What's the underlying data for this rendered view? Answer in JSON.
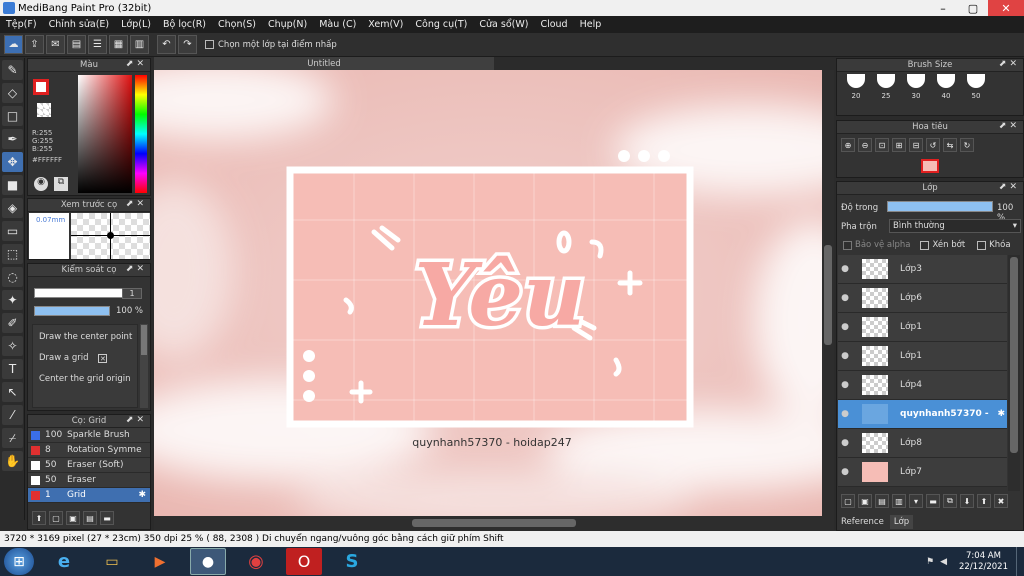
{
  "window": {
    "title": "MediBang Paint Pro (32bit)"
  },
  "menu": [
    "Tệp(F)",
    "Chỉnh sửa(E)",
    "Lớp(L)",
    "Bộ lọc(R)",
    "Chọn(S)",
    "Chụp(N)",
    "Màu (C)",
    "Xem(V)",
    "Công cụ(T)",
    "Cửa sổ(W)",
    "Cloud",
    "Help"
  ],
  "toolbar": {
    "select_layer_label": "Chọn một lớp tại điểm nhấp"
  },
  "canvas": {
    "tab_title": "Untitled",
    "art_word": "Yêu",
    "watermark": "quynhanh57370 - hoidap247"
  },
  "color_panel": {
    "title": "Màu",
    "r": "R:255",
    "g": "G:255",
    "b": "B:255",
    "hex": "#FFFFFF"
  },
  "brush_preview": {
    "title": "Xem trước cọ",
    "size": "0.07mm"
  },
  "brush_control": {
    "title": "Kiểm soát cọ",
    "size_value": "1",
    "opacity_value": "100 %",
    "options": [
      "Draw the center point",
      "Draw a grid",
      "Center the grid origin"
    ]
  },
  "brush_list": {
    "title": "Cọ: Grid",
    "items": [
      {
        "size": "100",
        "name": "Sparkle Brush",
        "color": "#3a6ee8"
      },
      {
        "size": "8",
        "name": "Rotation Symme",
        "color": "#e03030"
      },
      {
        "size": "50",
        "name": "Eraser (Soft)",
        "color": "#ffffff"
      },
      {
        "size": "50",
        "name": "Eraser",
        "color": "#ffffff"
      },
      {
        "size": "1",
        "name": "Grid",
        "color": "#e03030"
      }
    ]
  },
  "brush_size_panel": {
    "title": "Brush Size",
    "sizes": [
      "20",
      "25",
      "30",
      "40",
      "50"
    ]
  },
  "navigator": {
    "title": "Hoa tiêu"
  },
  "layers_panel": {
    "title": "Lớp",
    "opacity_label": "Độ trong",
    "opacity_value": "100 %",
    "blend_label": "Pha trộn",
    "blend_value": "Bình thường",
    "protect_alpha": "Bảo vệ alpha",
    "clipping": "Xén bớt",
    "lock": "Khóa",
    "layers": [
      "Lớp3",
      "Lớp6",
      "Lớp1",
      "Lớp1",
      "Lớp4",
      "quynhanh57370 -",
      "Lớp8",
      "Lớp7"
    ],
    "selected_index": 5,
    "tabs": [
      "Reference",
      "Lớp"
    ]
  },
  "status": {
    "text": "3720 * 3169 pixel   (27 * 23cm)   350 dpi   25 %   ( 88, 2308 )   Di chuyển ngang/vuông góc bằng cách giữ phím Shift"
  },
  "taskbar": {
    "time": "7:04 AM",
    "date": "22/12/2021"
  },
  "colors": {
    "accent": "#4a90d6",
    "panel": "#333333",
    "pink": "#f6bdb6"
  }
}
